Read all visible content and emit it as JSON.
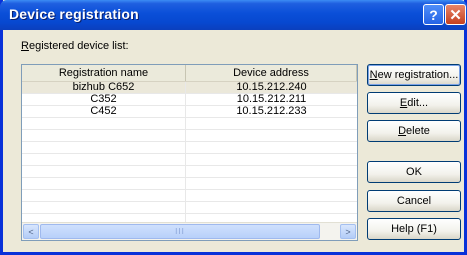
{
  "window": {
    "title": "Device registration",
    "help_glyph": "?",
    "close_glyph": "✕"
  },
  "list": {
    "label_mnemonic": "R",
    "label_rest": "egistered device list:",
    "columns": [
      "Registration name",
      "Device address"
    ],
    "rows": [
      {
        "name": "bizhub C652",
        "address": "10.15.212.240",
        "selected": true
      },
      {
        "name": "C352",
        "address": "10.15.212.211",
        "selected": false
      },
      {
        "name": "C452",
        "address": "10.15.212.233",
        "selected": false
      }
    ],
    "scroll_left_glyph": "<",
    "scroll_right_glyph": ">",
    "scroll_thumb_grip": "III"
  },
  "buttons": {
    "new_registration": {
      "mnemonic": "N",
      "rest": "ew registration..."
    },
    "edit": {
      "mnemonic": "E",
      "rest": "dit..."
    },
    "delete": {
      "mnemonic": "D",
      "rest": "elete"
    },
    "ok": "OK",
    "cancel": "Cancel",
    "help": "Help (F1)"
  },
  "colors": {
    "titlebar": "#0a4fd8",
    "dialog_bg": "#ece9d8",
    "selected_row": "#ebe8da"
  }
}
